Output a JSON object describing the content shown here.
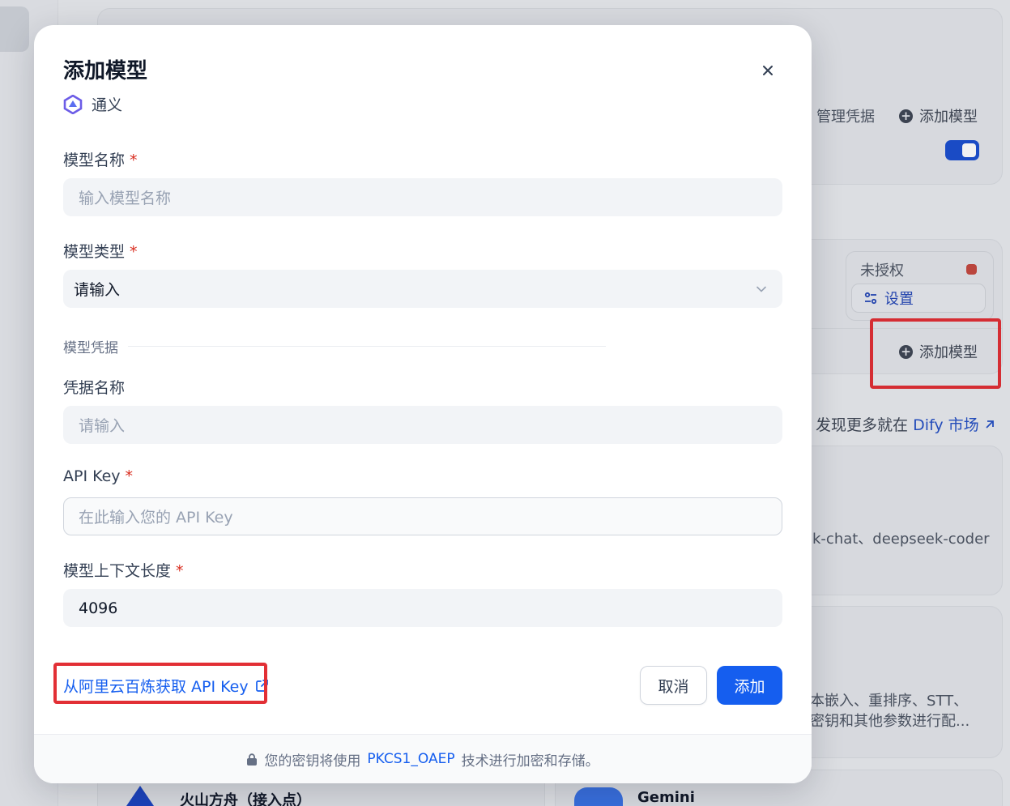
{
  "background": {
    "credentials_label": "管理凭据",
    "add_model_label": "添加模型",
    "unauthorized_label": "未授权",
    "settings_label": "设置",
    "add_model_label_2": "添加模型",
    "market_prefix": "发现更多就在",
    "market_link": "Dify 市场",
    "deepseek_desc": "k-chat、deepseek-coder",
    "features_line1": "本嵌入、重排序、STT、",
    "features_line2": "密钥和其他参数进行配...",
    "volcano_name": "火山方舟（接入点）",
    "gemini_name": "Gemini"
  },
  "dialog": {
    "title": "添加模型",
    "provider_name": "通义",
    "model_name": {
      "label": "模型名称",
      "required_mark": "*",
      "placeholder": "输入模型名称"
    },
    "model_type": {
      "label": "模型类型",
      "required_mark": "*",
      "value": "请输入"
    },
    "credentials_section": "模型凭据",
    "credential_name": {
      "label": "凭据名称",
      "placeholder": "请输入"
    },
    "api_key": {
      "label": "API Key",
      "required_mark": "*",
      "placeholder": "在此输入您的 API Key"
    },
    "context_length": {
      "label": "模型上下文长度",
      "required_mark": "*",
      "value": "4096"
    },
    "external_link": "从阿里云百炼获取 API Key",
    "cancel_label": "取消",
    "add_label": "添加",
    "footer": {
      "prefix": "您的密钥将使用",
      "highlight": "PKCS1_OAEP",
      "suffix": "技术进行加密和存储。"
    }
  },
  "colors": {
    "primary": "#155eef",
    "required": "#d92d20",
    "highlight_border": "#e22f35",
    "toggle_on": "#1b4fd0",
    "status_unauthorized": "#c5493f"
  },
  "icons": [
    "close-icon",
    "tongyi-logo-icon",
    "chevron-down-icon",
    "external-link-icon",
    "lock-icon",
    "plus-circle-icon",
    "settings-sliders-icon",
    "arrow-up-right-icon"
  ]
}
